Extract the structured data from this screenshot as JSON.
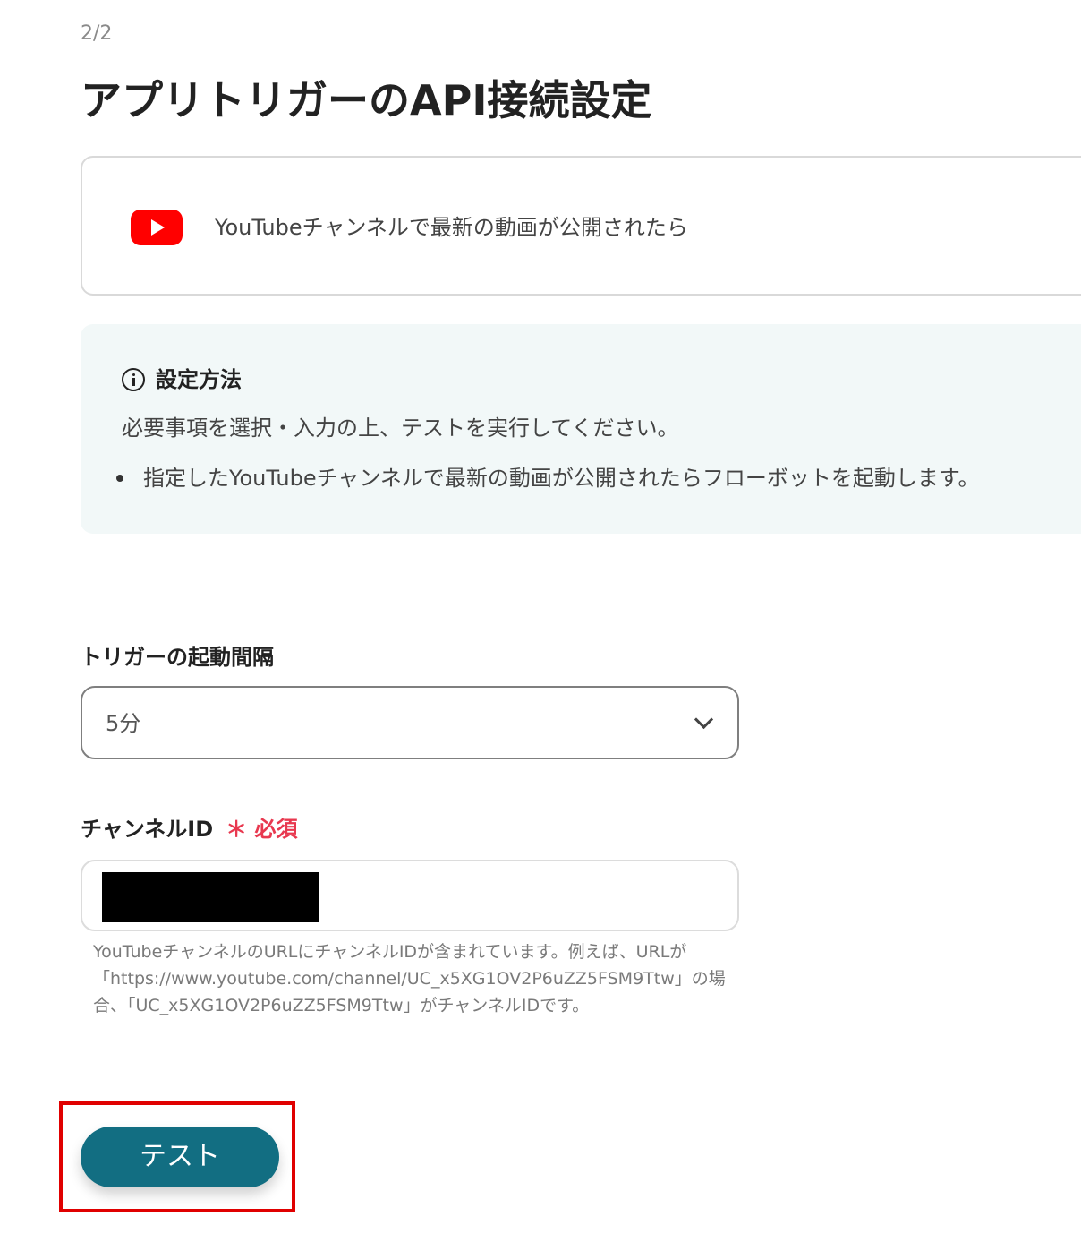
{
  "header": {
    "step": "2/2",
    "title": "アプリトリガーのAPI接続設定"
  },
  "app_card": {
    "icon": "youtube-logo",
    "text": "YouTubeチャンネルで最新の動画が公開されたら"
  },
  "info_box": {
    "icon": "info-icon",
    "title": "設定方法",
    "description": "必要事項を選択・入力の上、テストを実行してください。",
    "bullets": [
      "指定したYouTubeチャンネルで最新の動画が公開されたらフローボットを起動します。"
    ]
  },
  "interval_field": {
    "label": "トリガーの起動間隔",
    "value": "5分"
  },
  "channel_field": {
    "label": "チャンネルID",
    "required_mark": "＊ 必須",
    "value_redacted": true,
    "help_text": "YouTubeチャンネルのURLにチャンネルIDが含まれています。例えば、URLが「https://www.youtube.com/channel/UC_x5XG1OV2P6uZZ5FSM9Ttw」の場合、「UC_x5XG1OV2P6uZZ5FSM9Ttw」がチャンネルIDです。"
  },
  "actions": {
    "test_label": "テスト"
  },
  "colors": {
    "accent": "#126e82",
    "required": "#e8384f",
    "highlight": "#e00000",
    "youtube_red": "#ff0000",
    "info_bg": "#f2f8f8"
  }
}
